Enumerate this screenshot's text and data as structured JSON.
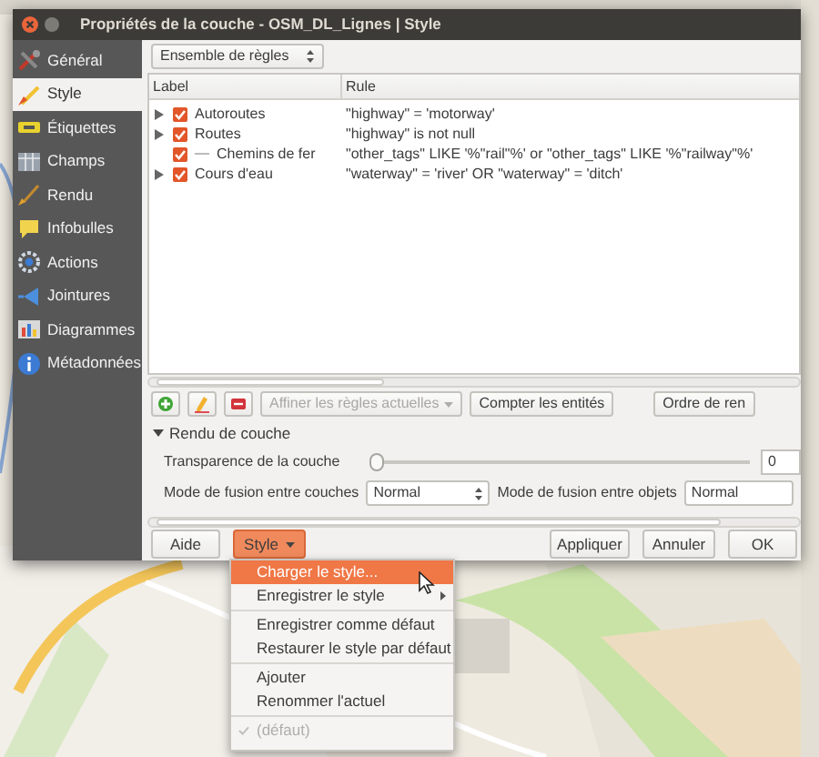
{
  "window": {
    "title": "Propriétés de la couche - OSM_DL_Lignes | Style"
  },
  "sidebar": {
    "items": [
      {
        "label": "Général",
        "selected": false
      },
      {
        "label": "Style",
        "selected": true
      },
      {
        "label": "Étiquettes",
        "selected": false
      },
      {
        "label": "Champs",
        "selected": false
      },
      {
        "label": "Rendu",
        "selected": false
      },
      {
        "label": "Infobulles",
        "selected": false
      },
      {
        "label": "Actions",
        "selected": false
      },
      {
        "label": "Jointures",
        "selected": false
      },
      {
        "label": "Diagrammes",
        "selected": false
      },
      {
        "label": "Métadonnées",
        "selected": false
      }
    ]
  },
  "renderer": {
    "value": "Ensemble de règles"
  },
  "rules": {
    "columns": [
      "Label",
      "Rule"
    ],
    "rows": [
      {
        "label": "Autoroutes",
        "rule": "\"highway\" = 'motorway'",
        "checked": true,
        "expandable": true
      },
      {
        "label": "Routes",
        "rule": "\"highway\" is not null",
        "checked": true,
        "expandable": true
      },
      {
        "label": "Chemins de fer",
        "rule": "\"other_tags\" LIKE '%\"rail\"%' or \"other_tags\" LIKE '%\"railway\"%'",
        "checked": true,
        "expandable": false
      },
      {
        "label": "Cours d'eau",
        "rule": "\"waterway\" = 'river' OR \"waterway\" = 'ditch'",
        "checked": true,
        "expandable": true
      }
    ]
  },
  "toolbar": {
    "refine": {
      "label": "Affiner les règles actuelles",
      "disabled": true
    },
    "count_button": "Compter les entités",
    "order_button": "Ordre de ren"
  },
  "layer_rendering": {
    "title": "Rendu de couche",
    "expanded": true,
    "transparency": {
      "label": "Transparence de la couche",
      "level": 0,
      "value": "0"
    },
    "layer_blend": {
      "label": "Mode de fusion entre couches",
      "value": "Normal"
    },
    "feature_blend": {
      "label": "Mode de fusion entre objets",
      "value": "Normal"
    }
  },
  "buttons": [
    {
      "label": "Aide",
      "kind": "plain",
      "selected": false
    },
    {
      "label": "Style",
      "kind": "menu",
      "selected": true
    },
    {
      "label": "Appliquer",
      "kind": "plain",
      "selected": false
    },
    {
      "label": "Annuler",
      "kind": "plain",
      "selected": false
    },
    {
      "label": "OK",
      "kind": "plain",
      "selected": false
    }
  ],
  "style_menu": {
    "items": [
      {
        "kind": "item",
        "label": "Charger le style...",
        "selected": true
      },
      {
        "kind": "submenu",
        "label": "Enregistrer le style",
        "selected": false
      },
      {
        "kind": "separator"
      },
      {
        "kind": "item",
        "label": "Enregistrer comme défaut",
        "selected": false
      },
      {
        "kind": "item",
        "label": "Restaurer le style par défaut",
        "selected": false
      },
      {
        "kind": "separator"
      },
      {
        "kind": "item",
        "label": "Ajouter",
        "selected": false
      },
      {
        "kind": "item",
        "label": "Renommer l'actuel",
        "selected": false
      },
      {
        "kind": "separator"
      },
      {
        "kind": "check",
        "label": "(défaut)",
        "checked": true,
        "disabled": true,
        "selected": false
      }
    ]
  }
}
